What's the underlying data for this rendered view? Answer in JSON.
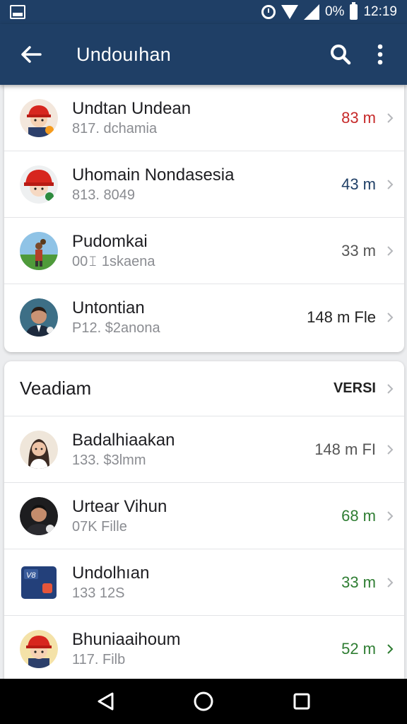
{
  "status_bar": {
    "battery_text": "0%",
    "time": "12:19",
    "icons": [
      "screen-icon",
      "alarm-icon",
      "wifi-icon",
      "signal-icon",
      "battery-icon"
    ]
  },
  "app_bar": {
    "title": "Undouıhan",
    "icons": [
      "back-arrow-icon",
      "search-icon",
      "more-vert-icon"
    ],
    "color": "#1f3f66"
  },
  "list1": [
    {
      "name": "Undtan Undean",
      "sub": "817. dchamia",
      "value": "83 m",
      "value_color": "#c62828",
      "avatar": "person-red-cap-avatar"
    },
    {
      "name": "Uhomain Nondasesia",
      "sub": "813. 8049",
      "value": "43 m",
      "value_color": "#1f3f66",
      "avatar": "person-red-cap-avatar"
    },
    {
      "name": "Pudomkai",
      "sub": "00𝙸 1skaena",
      "value": "33 m",
      "value_color": "#555555",
      "avatar": "landscape-person-avatar"
    },
    {
      "name": "Untontian",
      "sub": "P12. $2anona",
      "value": "148 m Fle",
      "value_color": "#222222",
      "avatar": "man-suit-avatar"
    }
  ],
  "section2": {
    "title": "Veadiam",
    "action": "VERSI"
  },
  "list2": [
    {
      "name": "Badalhiaakan",
      "sub": "133. $3lmm",
      "value": "148 m FI",
      "value_color": "#555555",
      "avatar": "woman-avatar"
    },
    {
      "name": "Urtear Vihun",
      "sub": "07K Fille",
      "value": "68 m",
      "value_color": "#2e7d32",
      "avatar": "man-avatar"
    },
    {
      "name": "Undolhıan",
      "sub": "133 12S",
      "value": "33 m",
      "value_color": "#2e7d32",
      "avatar": "app-tile-avatar",
      "tile_text": "V8"
    },
    {
      "name": "Bhuniaaihoum",
      "sub": "117. Filb",
      "value": "52 m",
      "value_color": "#2e7d32",
      "avatar": "person-red-cap-avatar"
    }
  ],
  "nav_bar": {
    "icons": [
      "back-triangle-icon",
      "home-circle-icon",
      "recents-square-icon"
    ]
  }
}
